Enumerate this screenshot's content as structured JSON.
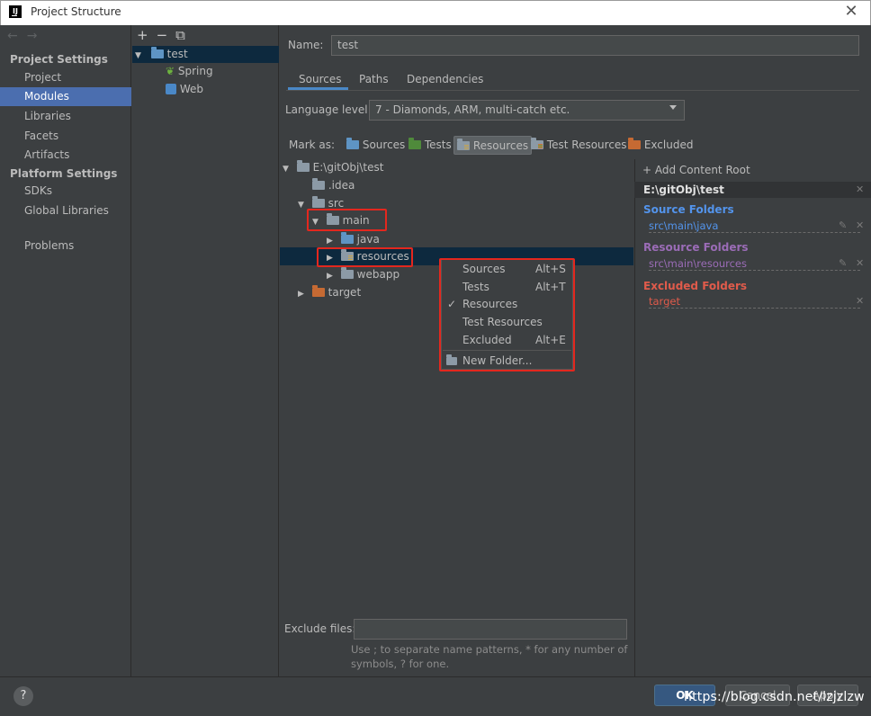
{
  "window": {
    "title": "Project Structure",
    "close_icon": "close-icon"
  },
  "nav": {
    "back": "←",
    "forward": "→",
    "project_settings": "Project Settings",
    "platform_settings": "Platform Settings",
    "items": [
      "Project",
      "Modules",
      "Libraries",
      "Facets",
      "Artifacts"
    ],
    "platform_items": [
      "SDKs",
      "Global Libraries"
    ],
    "problems": "Problems",
    "selected": "Modules"
  },
  "modules_toolbar": {
    "add": "+",
    "remove": "−",
    "copy": "⧉"
  },
  "modules": {
    "root": "test",
    "children": [
      "Spring",
      "Web"
    ]
  },
  "module": {
    "name_label": "Name:",
    "name_value": "test",
    "tabs": [
      "Sources",
      "Paths",
      "Dependencies"
    ],
    "active_tab": "Sources",
    "language_level_label": "Language level:",
    "language_level_value": "7 - Diamonds, ARM, multi-catch etc.",
    "mark_as_label": "Mark as:",
    "mark_as": [
      "Sources",
      "Tests",
      "Resources",
      "Test Resources",
      "Excluded"
    ],
    "mark_as_active": "Resources"
  },
  "tree": {
    "root": "E:\\gitObj\\test",
    "idea": ".idea",
    "src": "src",
    "main": "main",
    "java": "java",
    "resources": "resources",
    "webapp": "webapp",
    "target": "target"
  },
  "context_menu": {
    "items": [
      {
        "label": "Sources",
        "shortcut": "Alt+S"
      },
      {
        "label": "Tests",
        "shortcut": "Alt+T"
      },
      {
        "label": "Resources",
        "shortcut": "",
        "checked": "✓"
      },
      {
        "label": "Test Resources",
        "shortcut": ""
      },
      {
        "label": "Excluded",
        "shortcut": "Alt+E"
      }
    ],
    "new_folder": "New Folder..."
  },
  "content_root": {
    "add_label": "+ Add Content Root",
    "path": "E:\\gitObj\\test",
    "source_title": "Source Folders",
    "source_item": "src\\main\\java",
    "resource_title": "Resource Folders",
    "resource_item": "src\\main\\resources",
    "excluded_title": "Excluded Folders",
    "excluded_item": "target",
    "colors": {
      "source": "#5394ec",
      "resource": "#9b6cb7",
      "excluded": "#e05b4b"
    }
  },
  "exclude": {
    "label": "Exclude files:",
    "value": "",
    "hint": "Use ; to separate name patterns, * for any number of symbols, ? for one."
  },
  "footer": {
    "help": "?",
    "ok": "OK",
    "cancel": "Cancel",
    "apply": "Apply",
    "watermark": "https://blog.csdn.net/lzjzlzw"
  }
}
